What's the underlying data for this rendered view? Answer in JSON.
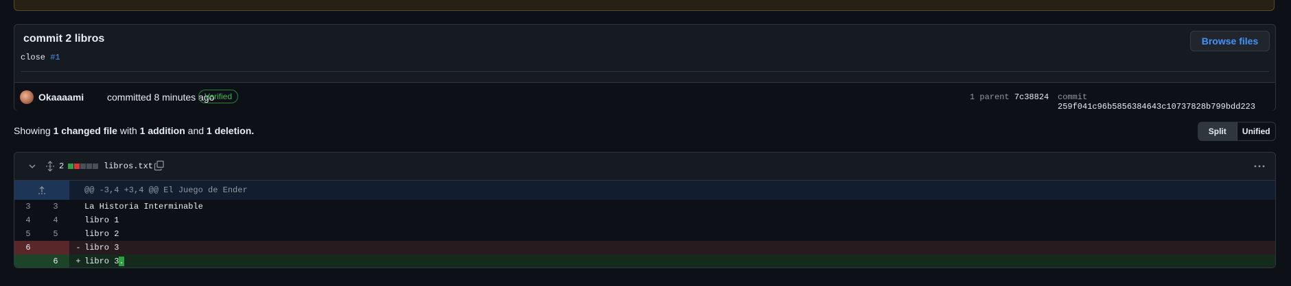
{
  "commit": {
    "title": "commit 2 libros",
    "message_prefix": "close",
    "message_link": "#1",
    "browse_label": "Browse files",
    "author": "Okaaaami",
    "committed_text": "committed 8 minutes ago",
    "verified_label": "Verified",
    "parent_label": "1 parent",
    "parent_sha": "7c38824",
    "commit_label": "commit",
    "commit_sha": "259f041c96b5856384643c10737828b799bdd223"
  },
  "summary": {
    "showing": "Showing",
    "changed": "1 changed file",
    "with": "with",
    "additions": "1 addition",
    "and": "and",
    "deletions": "1 deletion."
  },
  "view_toggle": {
    "split": "Split",
    "unified": "Unified"
  },
  "file": {
    "changes_count": "2",
    "name": "libros.txt",
    "hunk_header": "@@ -3,4 +3,4 @@ El Juego de Ender",
    "lines": [
      {
        "old": "3",
        "new": "3",
        "sign": "",
        "text": "La Historia Interminable",
        "type": "context"
      },
      {
        "old": "4",
        "new": "4",
        "sign": "",
        "text": "libro 1",
        "type": "context"
      },
      {
        "old": "5",
        "new": "5",
        "sign": "",
        "text": "libro 2",
        "type": "context"
      },
      {
        "old": "6",
        "new": "",
        "sign": "-",
        "text": "libro 3",
        "type": "del"
      },
      {
        "old": "",
        "new": "6",
        "sign": "+",
        "text": "libro 3",
        "added_part": ".",
        "type": "add"
      }
    ]
  },
  "colors": {
    "accent": "#4493f8",
    "added": "#2ea043",
    "deleted": "#da3633"
  }
}
